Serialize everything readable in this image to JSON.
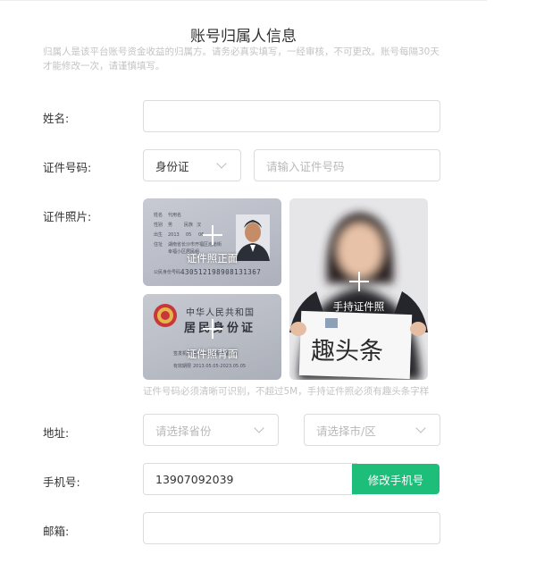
{
  "page": {
    "title": "账号归属人信息",
    "description": "归属人是该平台账号资金收益的归属方。请务必真实填写，一经审核，不可更改。账号每隔30天才能修改一次，请谨慎填写。"
  },
  "form": {
    "name": {
      "label": "姓名:",
      "value": ""
    },
    "id_number": {
      "label": "证件号码:",
      "type_selected": "身份证",
      "placeholder": "请输入证件号码"
    },
    "id_photos": {
      "label": "证件照片:",
      "front_caption": "证件照正面",
      "back_caption": "证件照背面",
      "handheld_caption": "手持证件照",
      "hint": "证件号码必须清晰可识别，不超过5M，手持证件照必须有趣头条字样",
      "front_card_text": {
        "name_label": "姓名",
        "name": "代用名",
        "sex_label": "性别",
        "sex": "男",
        "nation_label": "民族",
        "nation": "汉",
        "birth_label": "出生",
        "birth_year": "2013",
        "birth_month": "05",
        "birth_day": "06",
        "addr_label": "住址",
        "addr_line1": "湖南省长沙市开福区巡道街",
        "addr_line2": "幸福小区居民组",
        "number_label": "公民身份号码",
        "number": "430512198908131367"
      },
      "back_card_text": {
        "country": "中华人民共和国",
        "card_name": "居民身份证",
        "authority_label": "签发机关",
        "authority": "长沙市公安局开福分局",
        "validity_label": "有效期限",
        "validity": "2013.05.05-2023.05.05"
      },
      "handheld_sign_text": "趣头条"
    },
    "address": {
      "label": "地址:",
      "province_placeholder": "请选择省份",
      "city_placeholder": "请选择市/区"
    },
    "phone": {
      "label": "手机号:",
      "value": "13907092039",
      "button": "修改手机号"
    },
    "email": {
      "label": "邮箱:",
      "value": ""
    }
  },
  "colors": {
    "accent": "#1dbe7a",
    "hint": "#c4c4c4",
    "border": "#dcdcdc"
  },
  "icons": {
    "upload": "plus-icon",
    "dropdown": "chevron-down-icon",
    "emblem": "national-emblem-icon"
  }
}
